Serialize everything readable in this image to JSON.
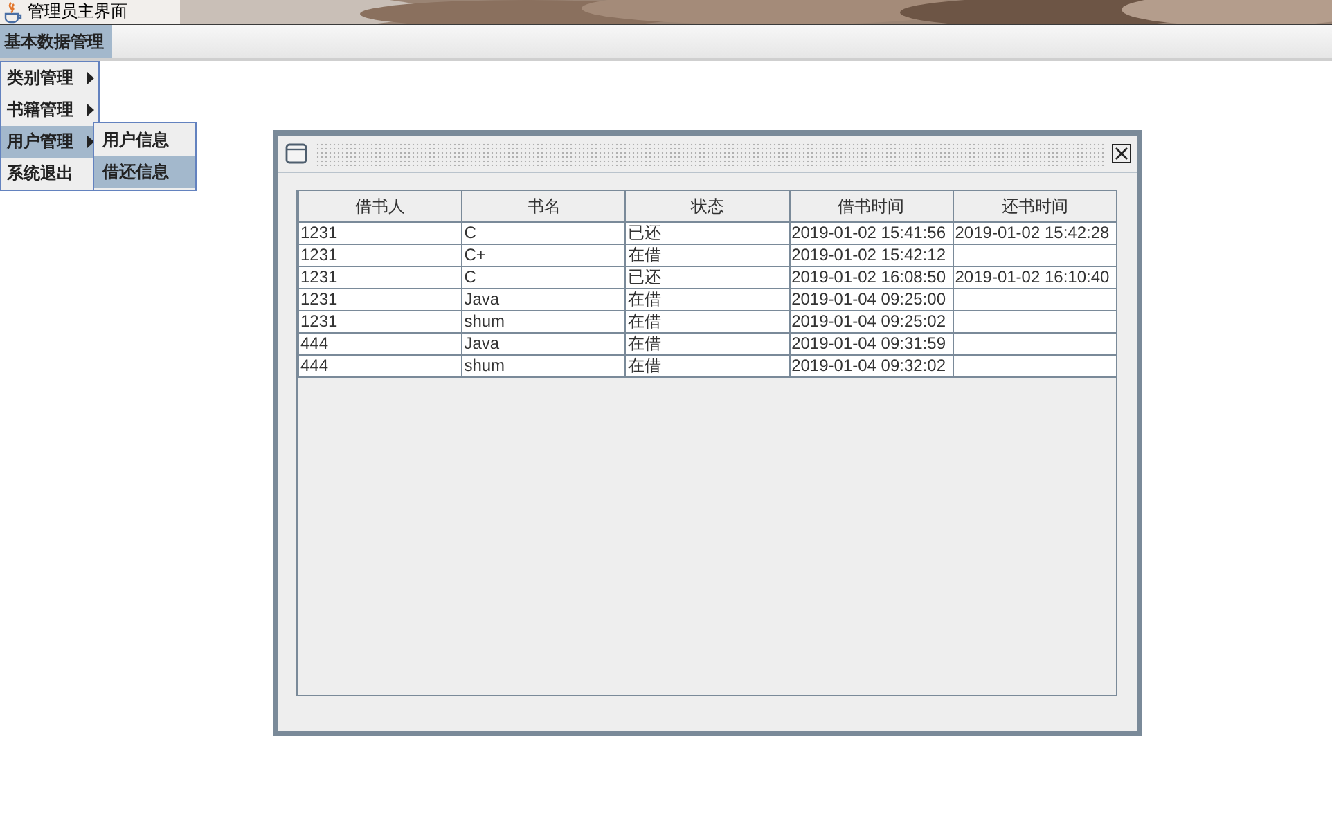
{
  "window": {
    "title": "管理员主界面"
  },
  "menu_bar": [
    {
      "label": "基本数据管理",
      "selected": true
    }
  ],
  "menu": {
    "items": [
      {
        "label": "类别管理",
        "kind": "submenu",
        "selected": false
      },
      {
        "label": "书籍管理",
        "kind": "submenu",
        "selected": false
      },
      {
        "label": "用户管理",
        "kind": "submenu",
        "selected": true
      },
      {
        "label": "系统退出",
        "kind": "item",
        "selected": false
      }
    ]
  },
  "submenu": {
    "items": [
      {
        "label": "用户信息",
        "selected": false
      },
      {
        "label": "借还信息",
        "selected": true
      }
    ]
  },
  "internal_frame": {
    "table": {
      "columns": [
        "借书人",
        "书名",
        "状态",
        "借书时间",
        "还书时间"
      ],
      "rows": [
        {
          "borrower": "1231",
          "book": "C",
          "status": "已还",
          "borrow_time": "2019-01-02 15:41:56",
          "return_time": "2019-01-02 15:42:28"
        },
        {
          "borrower": "1231",
          "book": "C+",
          "status": "在借",
          "borrow_time": "2019-01-02 15:42:12"
        },
        {
          "borrower": "1231",
          "book": "C",
          "status": "已还",
          "borrow_time": "2019-01-02 16:08:50",
          "return_time": "2019-01-02 16:10:40"
        },
        {
          "borrower": "1231",
          "book": "Java",
          "status": "在借",
          "borrow_time": "2019-01-04 09:25:00"
        },
        {
          "borrower": "1231",
          "book": "shum",
          "status": "在借",
          "borrow_time": "2019-01-04 09:25:02"
        },
        {
          "borrower": "444",
          "book": "Java",
          "status": "在借",
          "borrow_time": "2019-01-04 09:31:59"
        },
        {
          "borrower": "444",
          "book": "shum",
          "status": "在借",
          "borrow_time": "2019-01-04 09:32:02"
        }
      ]
    }
  }
}
